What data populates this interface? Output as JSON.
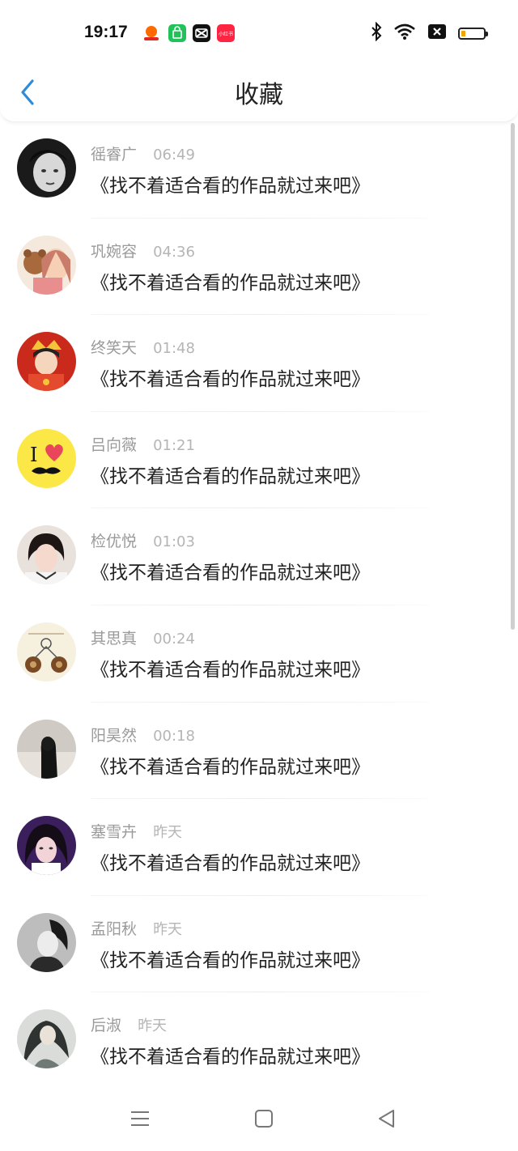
{
  "status_bar": {
    "time": "19:17",
    "battery_level": 0.2,
    "notification_icons": [
      "taobao-icon",
      "shop-bag-icon",
      "capcut-icon",
      "xiaohongshu-icon"
    ],
    "xiaohongshu_label": "小红书"
  },
  "header": {
    "title": "收藏",
    "accent_color": "#2e8bd8"
  },
  "items": [
    {
      "name": "徭睿广",
      "time": "06:49",
      "message": "《找不着适合看的作品就过来吧》"
    },
    {
      "name": "巩婉容",
      "time": "04:36",
      "message": "《找不着适合看的作品就过来吧》"
    },
    {
      "name": "终笑天",
      "time": "01:48",
      "message": "《找不着适合看的作品就过来吧》"
    },
    {
      "name": "吕向薇",
      "time": "01:21",
      "message": "《找不着适合看的作品就过来吧》"
    },
    {
      "name": "检优悦",
      "time": "01:03",
      "message": "《找不着适合看的作品就过来吧》"
    },
    {
      "name": "其思真",
      "time": "00:24",
      "message": "《找不着适合看的作品就过来吧》"
    },
    {
      "name": "阳昊然",
      "time": "00:18",
      "message": "《找不着适合看的作品就过来吧》"
    },
    {
      "name": "塞雪卉",
      "time": "昨天",
      "message": "《找不着适合看的作品就过来吧》"
    },
    {
      "name": "孟阳秋",
      "time": "昨天",
      "message": "《找不着适合看的作品就过来吧》"
    },
    {
      "name": "后淑",
      "time": "昨天",
      "message": "《找不着适合看的作品就过来吧》"
    }
  ],
  "avatar_icon_text": "I"
}
